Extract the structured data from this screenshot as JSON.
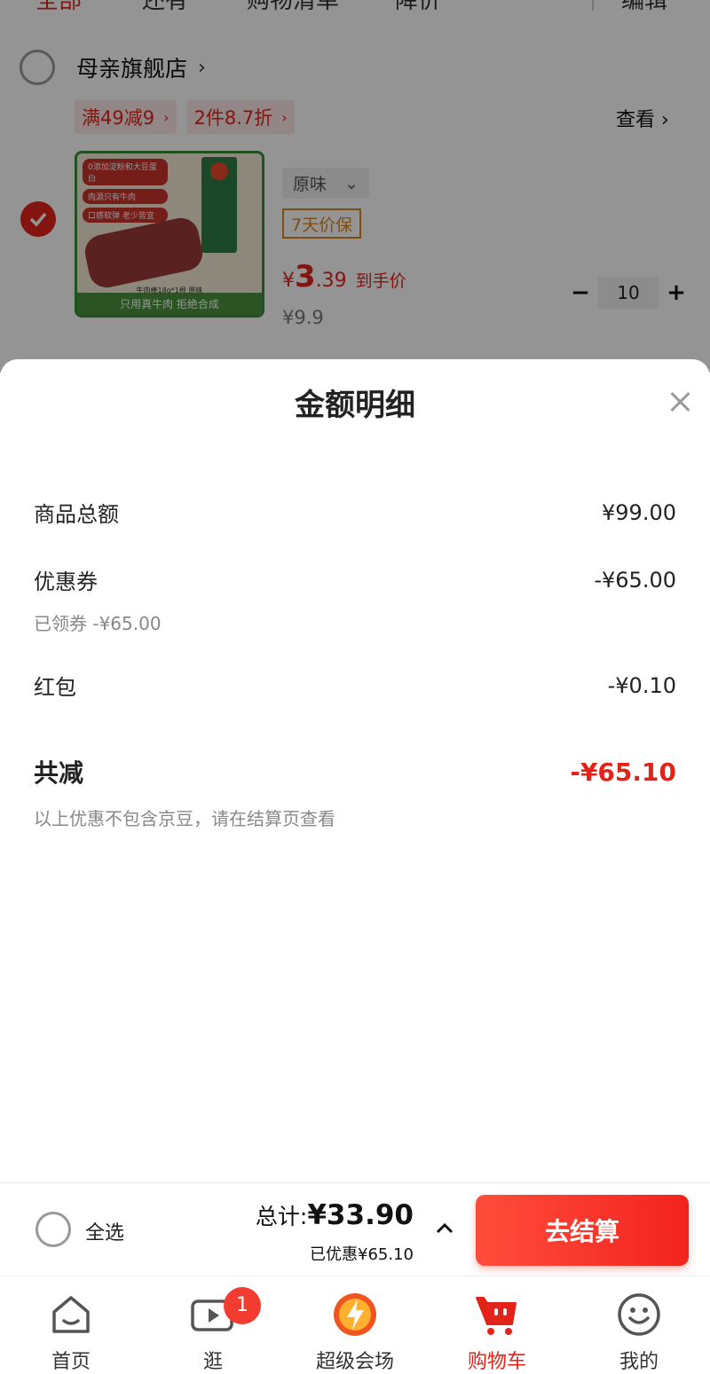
{
  "top_tabs": {
    "active": "全部",
    "items": [
      "全部",
      "还有",
      "购物清单",
      "降价"
    ],
    "right": "编辑"
  },
  "store": {
    "name": "母亲旗舰店",
    "chevron": "›",
    "promo_tags": [
      {
        "label": "满49减9",
        "chevron": "›"
      },
      {
        "label": "2件8.7折",
        "chevron": "›"
      }
    ],
    "view_link": "查看 ›"
  },
  "product": {
    "image_bullets": [
      "0添加淀粉和大豆蛋白",
      "肉源只有牛肉",
      "口感软弹 老少皆宜"
    ],
    "image_caption": "只用真牛肉 拒绝合成",
    "image_sub": "牛肉棒18g*1根 原味",
    "sku": "原味",
    "sku_chevron": "⌄",
    "guarantee": "7天价保",
    "price_symbol": "¥",
    "price_int": "3",
    "price_dec": ".39",
    "price_tag": "到手价",
    "old_price": "¥9.9",
    "quantity": "10",
    "minus": "−",
    "plus": "+"
  },
  "sheet": {
    "title": "金额明细",
    "rows": [
      {
        "label": "商品总额",
        "value": "¥99.00"
      },
      {
        "label": "优惠券",
        "value": "-¥65.00",
        "sub": "已领券 -¥65.00"
      },
      {
        "label": "红包",
        "value": "-¥0.10"
      }
    ],
    "total_label": "共减",
    "total_value": "-¥65.10",
    "note": "以上优惠不包含京豆，请在结算页查看"
  },
  "checkout": {
    "select_all": "全选",
    "total_prefix": "总计:",
    "total_amount": "¥33.90",
    "saved": "已优惠¥65.10",
    "button": "去结算"
  },
  "tabbar": [
    {
      "label": "首页",
      "icon": "home-icon"
    },
    {
      "label": "逛",
      "icon": "video-icon",
      "badge": "1"
    },
    {
      "label": "超级会场",
      "icon": "super-venue-icon"
    },
    {
      "label": "购物车",
      "icon": "cart-icon",
      "active": true
    },
    {
      "label": "我的",
      "icon": "smiley-icon"
    }
  ],
  "colors": {
    "accent": "#e2231a",
    "guarantee": "#d8861e",
    "promo_bg": "#fbe7e7"
  }
}
